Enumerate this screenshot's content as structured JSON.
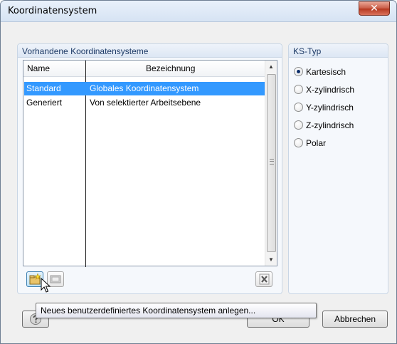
{
  "window": {
    "title": "Koordinatensystem",
    "close_glyph": "✕"
  },
  "left_group": {
    "title": "Vorhandene Koordinatensysteme",
    "columns": [
      "Name",
      "Bezeichnung"
    ],
    "rows": [
      {
        "name": "Standard",
        "description": "Globales Koordinatensystem",
        "selected": true
      },
      {
        "name": "Generiert",
        "description": "Von selektierter Arbeitsebene",
        "selected": false
      }
    ],
    "tools": {
      "new_icon": "new-folder-icon",
      "copy_icon": "copy-icon",
      "delete_icon": "delete-icon"
    }
  },
  "right_group": {
    "title": "KS-Typ",
    "options": [
      {
        "label": "Kartesisch",
        "checked": true
      },
      {
        "label": "X-zylindrisch",
        "checked": false
      },
      {
        "label": "Y-zylindrisch",
        "checked": false
      },
      {
        "label": "Z-zylindrisch",
        "checked": false
      },
      {
        "label": "Polar",
        "checked": false
      }
    ]
  },
  "buttons": {
    "ok": "OK",
    "cancel": "Abbrechen",
    "help_icon": "help-icon"
  },
  "tooltip": {
    "text": "Neues benutzerdefiniertes Koordinatensystem anlegen..."
  },
  "colors": {
    "selection": "#3399ff",
    "close": "#c85a44",
    "group_title": "#1d3a66"
  }
}
